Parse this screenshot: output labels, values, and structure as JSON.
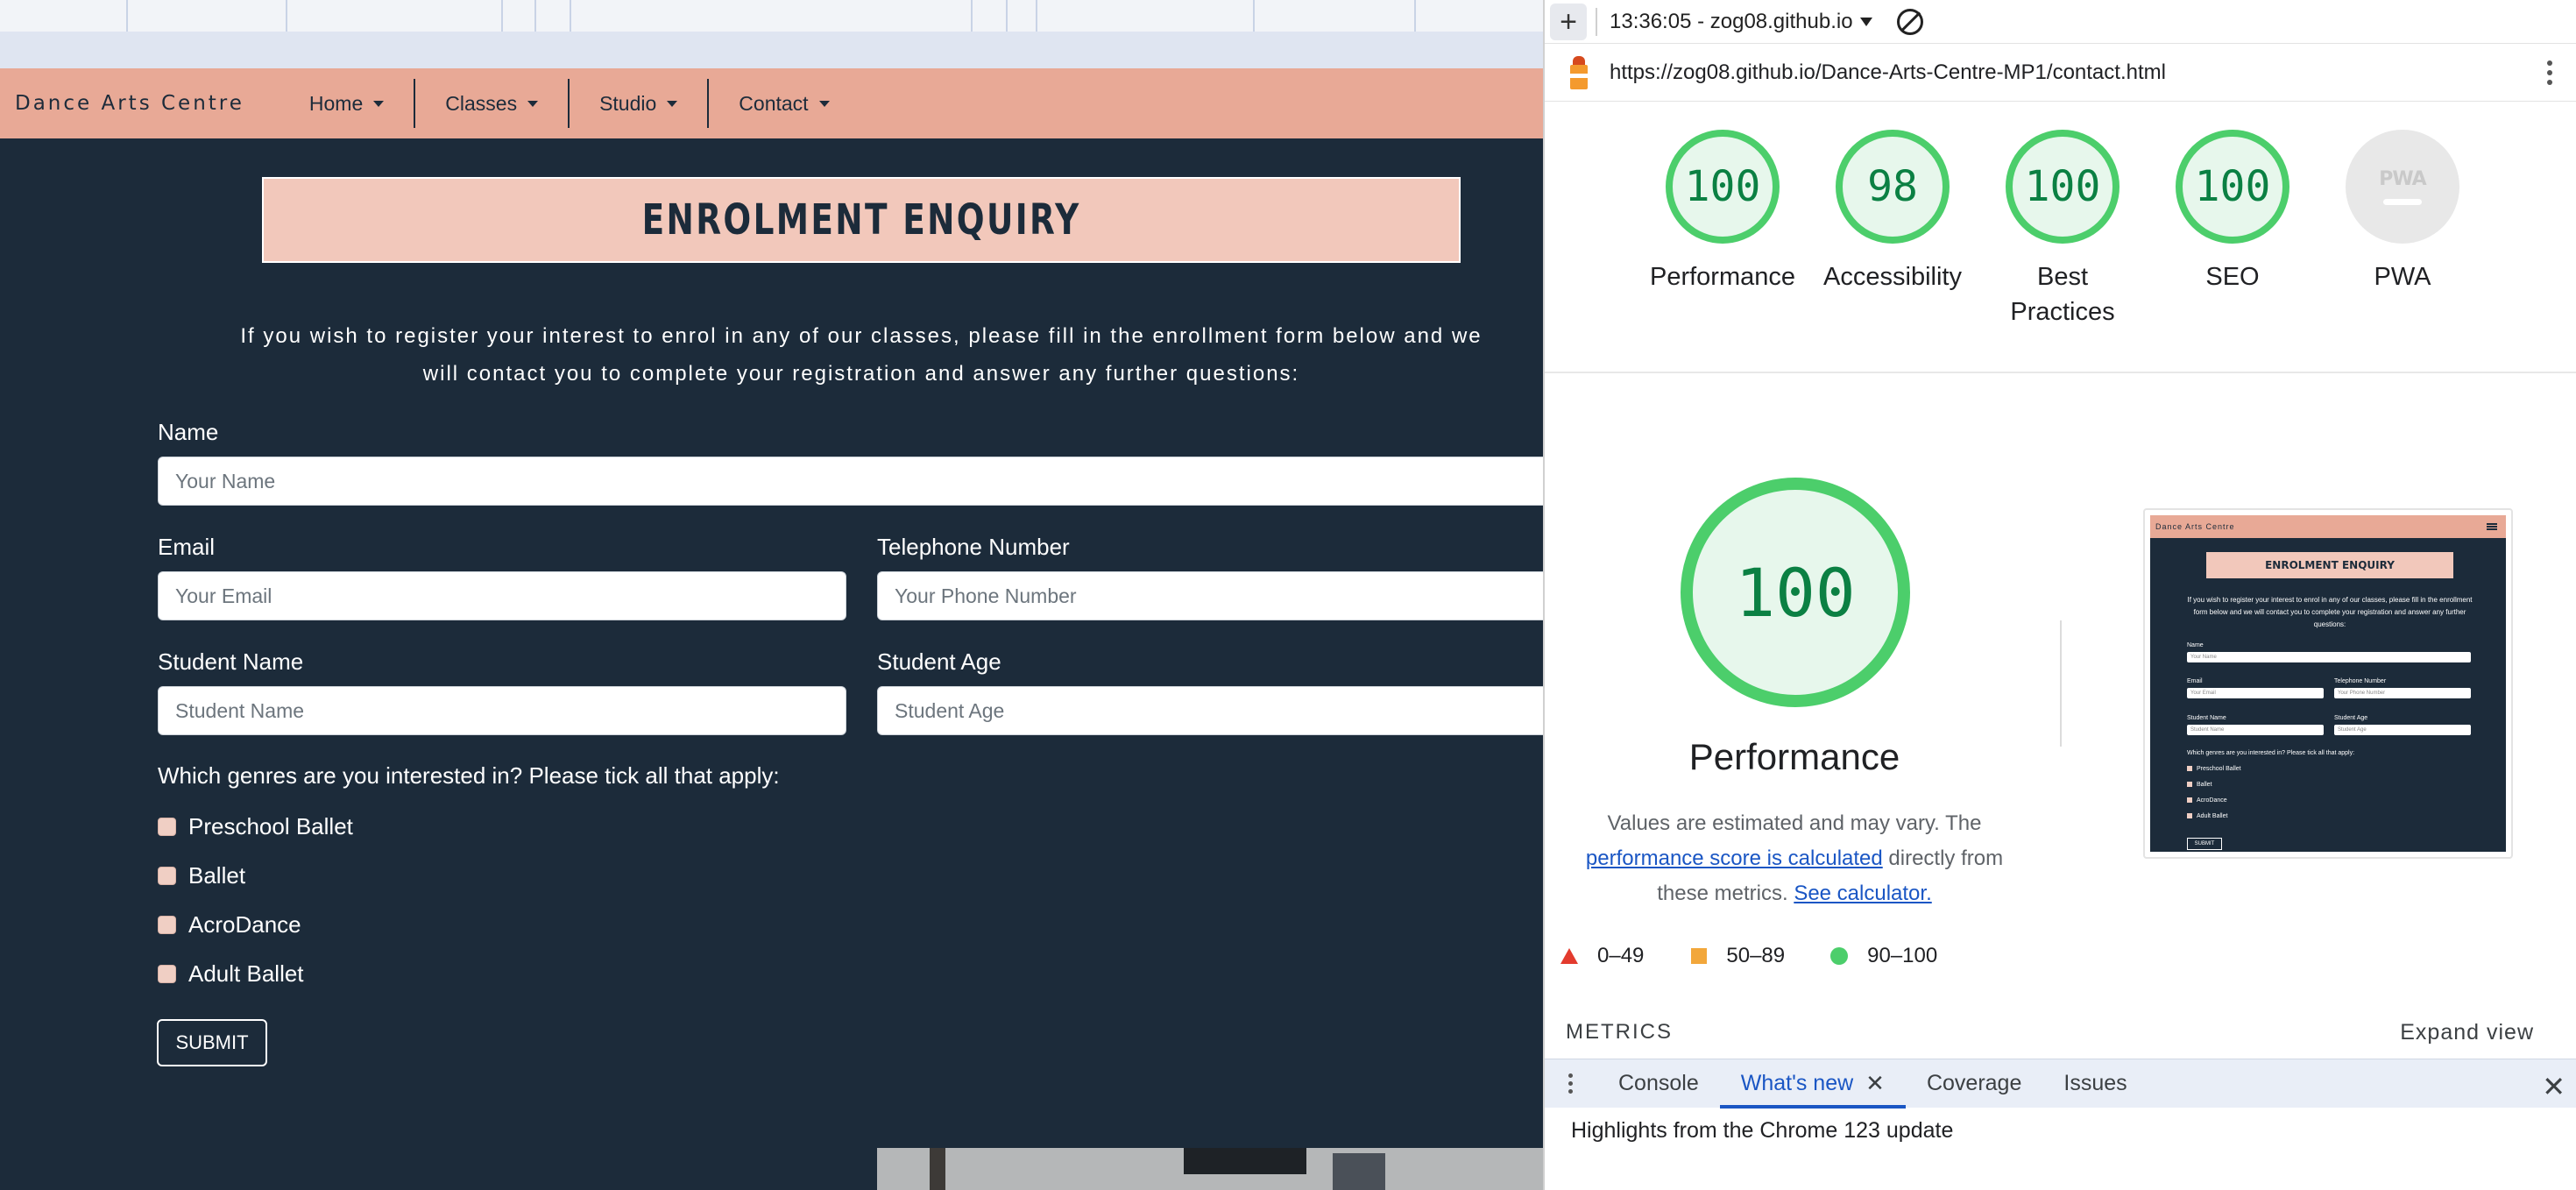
{
  "site": {
    "brand": "Dance Arts Centre",
    "nav": [
      "Home",
      "Classes",
      "Studio",
      "Contact"
    ],
    "banner": "ENROLMENT ENQUIRY",
    "intro": "If you wish to register your interest to enrol in any of our classes, please fill in the enrollment form below and we will contact you to complete your registration and answer any further questions:",
    "form": {
      "name_label": "Name",
      "name_placeholder": "Your Name",
      "email_label": "Email",
      "email_placeholder": "Your Email",
      "phone_label": "Telephone Number",
      "phone_placeholder": "Your Phone Number",
      "student_name_label": "Student Name",
      "student_name_placeholder": "Student Name",
      "student_age_label": "Student Age",
      "student_age_placeholder": "Student Age",
      "genres_question": "Which genres are you interested in? Please tick all that apply:",
      "genres": [
        "Preschool Ballet",
        "Ballet",
        "AcroDance",
        "Adult Ballet"
      ],
      "submit": "SUBMIT"
    }
  },
  "devtools": {
    "report_selector": "13:36:05 - zog08.github.io",
    "url": "https://zog08.github.io/Dance-Arts-Centre-MP1/contact.html",
    "scores": [
      {
        "score": "100",
        "label": "Performance"
      },
      {
        "score": "98",
        "label": "Accessibility"
      },
      {
        "score": "100",
        "label": "Best Practices"
      },
      {
        "score": "100",
        "label": "SEO"
      },
      {
        "score": "",
        "label": "PWA"
      }
    ],
    "pwa_badge": "PWA",
    "performance": {
      "score": "100",
      "title": "Performance",
      "desc_1": "Values are estimated and may vary. The",
      "desc_link": "performance score is calculated",
      "desc_2": "directly from these metrics.",
      "calc_link": "See calculator."
    },
    "legend": [
      "0–49",
      "50–89",
      "90–100"
    ],
    "metrics_header": "METRICS",
    "expand_view": "Expand view",
    "drawer_tabs": [
      "Console",
      "What's new",
      "Coverage",
      "Issues"
    ],
    "highlights": "Highlights from the Chrome 123 update"
  },
  "colors": {
    "site_bg": "#1c2b3a",
    "nav_bg": "#e8a996",
    "banner_bg": "#f2c8bb",
    "score_green": "#0b8043",
    "gauge_green": "#4cce6b",
    "link_blue": "#1a56c4"
  }
}
